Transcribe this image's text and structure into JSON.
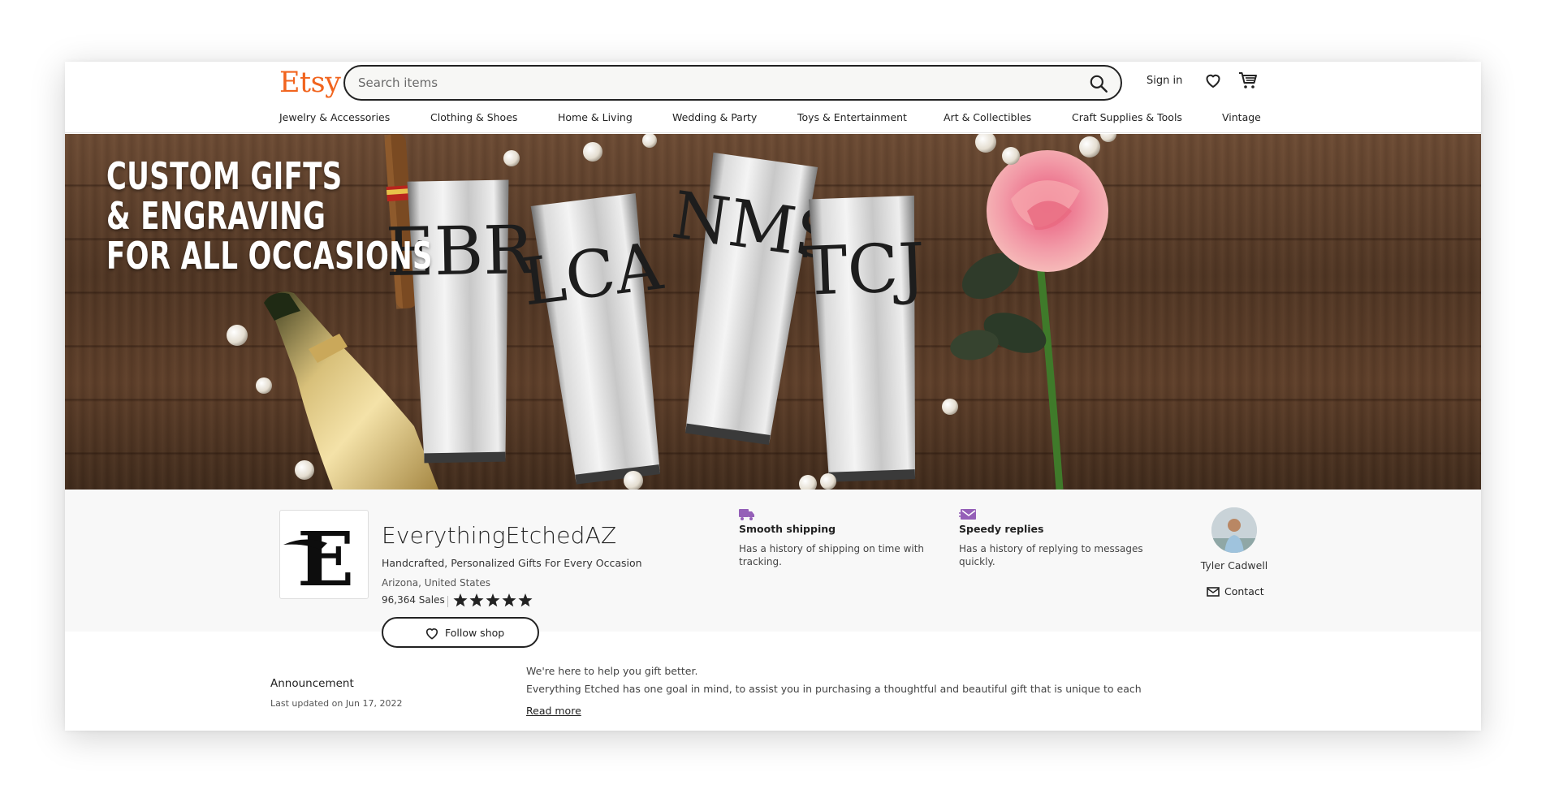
{
  "header": {
    "logo": "Etsy",
    "search": {
      "placeholder": "Search items",
      "value": ""
    },
    "signin_label": "Sign in"
  },
  "nav": {
    "items": [
      {
        "label": "Jewelry & Accessories"
      },
      {
        "label": "Clothing & Shoes"
      },
      {
        "label": "Home & Living"
      },
      {
        "label": "Wedding & Party"
      },
      {
        "label": "Toys & Entertainment"
      },
      {
        "label": "Art & Collectibles"
      },
      {
        "label": "Craft Supplies & Tools"
      },
      {
        "label": "Vintage"
      }
    ]
  },
  "banner": {
    "lines": [
      "CUSTOM GIFTS",
      "& ENGRAVING",
      "FOR ALL OCCASIONS"
    ],
    "monograms": [
      "EBR",
      "LCA",
      "NMS",
      "TCJ"
    ]
  },
  "shop": {
    "logo_letter": "E",
    "name": "EverythingEtchedAZ",
    "tagline": "Handcrafted, Personalized Gifts For Every Occasion",
    "location": "Arizona, United States",
    "sales": "96,364 Sales",
    "rating_stars": 5,
    "follow_label": "Follow shop"
  },
  "features": [
    {
      "icon": "truck-icon",
      "title": "Smooth shipping",
      "desc": "Has a history of shipping on time with tracking."
    },
    {
      "icon": "message-icon",
      "title": "Speedy replies",
      "desc": "Has a history of replying to messages quickly."
    }
  ],
  "owner": {
    "name": "Tyler Cadwell",
    "contact_label": "Contact"
  },
  "announcement": {
    "title": "Announcement",
    "date": "Last updated on Jun 17, 2022",
    "line1": "We're here to help you gift better.",
    "line2": "Everything Etched has one goal in mind, to assist you in purchasing a thoughtful and beautiful gift that is unique to each",
    "read_more": "Read more"
  },
  "colors": {
    "brand": "#f1641e",
    "feature_icon": "#9560b8"
  }
}
